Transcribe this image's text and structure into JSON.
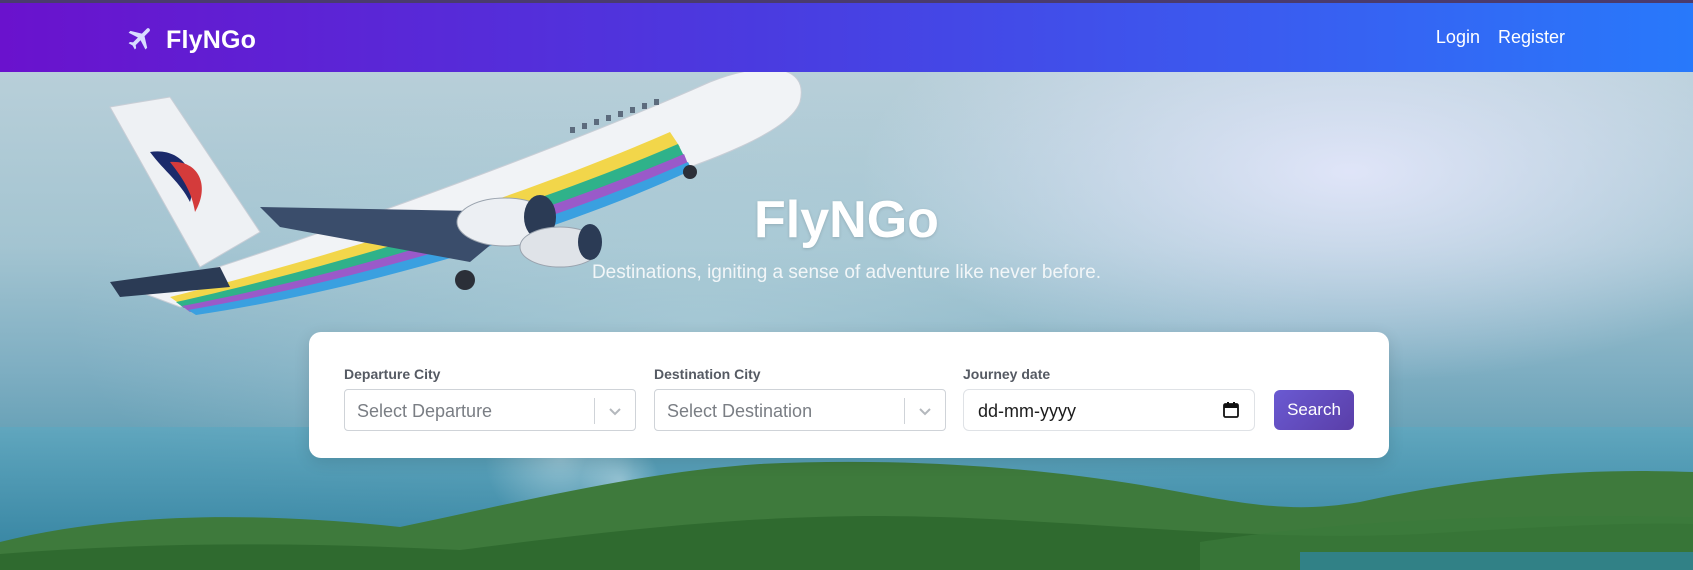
{
  "navbar": {
    "brand": "FlyNGo",
    "brand_icon": "airplane-icon",
    "links": {
      "login": "Login",
      "register": "Register"
    }
  },
  "hero": {
    "title": "FlyNGo",
    "subtitle": "Destinations, igniting a sense of adventure like never before."
  },
  "search": {
    "departure": {
      "label": "Departure City",
      "placeholder": "Select Departure"
    },
    "destination": {
      "label": "Destination City",
      "placeholder": "Select Destination"
    },
    "journey_date": {
      "label": "Journey date",
      "placeholder": "dd-mm-yyyy"
    },
    "button": "Search"
  },
  "colors": {
    "nav_start": "#6a12cd",
    "nav_end": "#2879fb",
    "search_button": "#6a5ad2"
  }
}
